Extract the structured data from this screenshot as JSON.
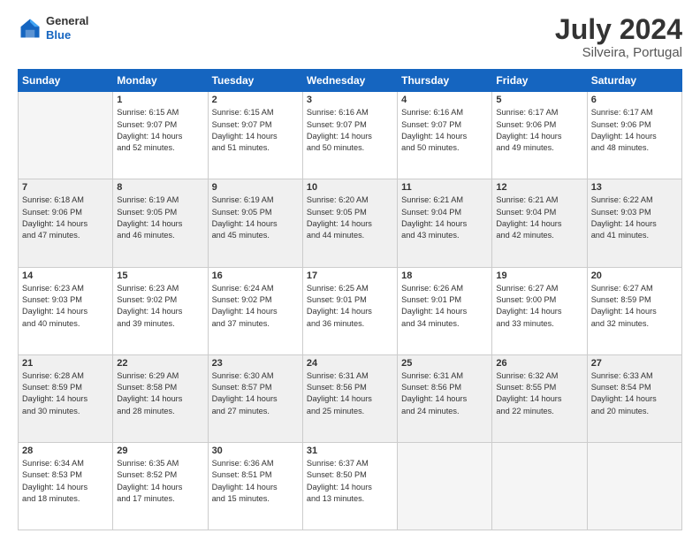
{
  "header": {
    "logo_line1": "General",
    "logo_line2": "Blue",
    "month_year": "July 2024",
    "location": "Silveira, Portugal"
  },
  "weekdays": [
    "Sunday",
    "Monday",
    "Tuesday",
    "Wednesday",
    "Thursday",
    "Friday",
    "Saturday"
  ],
  "weeks": [
    [
      {
        "day": "",
        "info": ""
      },
      {
        "day": "1",
        "info": "Sunrise: 6:15 AM\nSunset: 9:07 PM\nDaylight: 14 hours\nand 52 minutes."
      },
      {
        "day": "2",
        "info": "Sunrise: 6:15 AM\nSunset: 9:07 PM\nDaylight: 14 hours\nand 51 minutes."
      },
      {
        "day": "3",
        "info": "Sunrise: 6:16 AM\nSunset: 9:07 PM\nDaylight: 14 hours\nand 50 minutes."
      },
      {
        "day": "4",
        "info": "Sunrise: 6:16 AM\nSunset: 9:07 PM\nDaylight: 14 hours\nand 50 minutes."
      },
      {
        "day": "5",
        "info": "Sunrise: 6:17 AM\nSunset: 9:06 PM\nDaylight: 14 hours\nand 49 minutes."
      },
      {
        "day": "6",
        "info": "Sunrise: 6:17 AM\nSunset: 9:06 PM\nDaylight: 14 hours\nand 48 minutes."
      }
    ],
    [
      {
        "day": "7",
        "info": "Sunrise: 6:18 AM\nSunset: 9:06 PM\nDaylight: 14 hours\nand 47 minutes."
      },
      {
        "day": "8",
        "info": "Sunrise: 6:19 AM\nSunset: 9:05 PM\nDaylight: 14 hours\nand 46 minutes."
      },
      {
        "day": "9",
        "info": "Sunrise: 6:19 AM\nSunset: 9:05 PM\nDaylight: 14 hours\nand 45 minutes."
      },
      {
        "day": "10",
        "info": "Sunrise: 6:20 AM\nSunset: 9:05 PM\nDaylight: 14 hours\nand 44 minutes."
      },
      {
        "day": "11",
        "info": "Sunrise: 6:21 AM\nSunset: 9:04 PM\nDaylight: 14 hours\nand 43 minutes."
      },
      {
        "day": "12",
        "info": "Sunrise: 6:21 AM\nSunset: 9:04 PM\nDaylight: 14 hours\nand 42 minutes."
      },
      {
        "day": "13",
        "info": "Sunrise: 6:22 AM\nSunset: 9:03 PM\nDaylight: 14 hours\nand 41 minutes."
      }
    ],
    [
      {
        "day": "14",
        "info": "Sunrise: 6:23 AM\nSunset: 9:03 PM\nDaylight: 14 hours\nand 40 minutes."
      },
      {
        "day": "15",
        "info": "Sunrise: 6:23 AM\nSunset: 9:02 PM\nDaylight: 14 hours\nand 39 minutes."
      },
      {
        "day": "16",
        "info": "Sunrise: 6:24 AM\nSunset: 9:02 PM\nDaylight: 14 hours\nand 37 minutes."
      },
      {
        "day": "17",
        "info": "Sunrise: 6:25 AM\nSunset: 9:01 PM\nDaylight: 14 hours\nand 36 minutes."
      },
      {
        "day": "18",
        "info": "Sunrise: 6:26 AM\nSunset: 9:01 PM\nDaylight: 14 hours\nand 34 minutes."
      },
      {
        "day": "19",
        "info": "Sunrise: 6:27 AM\nSunset: 9:00 PM\nDaylight: 14 hours\nand 33 minutes."
      },
      {
        "day": "20",
        "info": "Sunrise: 6:27 AM\nSunset: 8:59 PM\nDaylight: 14 hours\nand 32 minutes."
      }
    ],
    [
      {
        "day": "21",
        "info": "Sunrise: 6:28 AM\nSunset: 8:59 PM\nDaylight: 14 hours\nand 30 minutes."
      },
      {
        "day": "22",
        "info": "Sunrise: 6:29 AM\nSunset: 8:58 PM\nDaylight: 14 hours\nand 28 minutes."
      },
      {
        "day": "23",
        "info": "Sunrise: 6:30 AM\nSunset: 8:57 PM\nDaylight: 14 hours\nand 27 minutes."
      },
      {
        "day": "24",
        "info": "Sunrise: 6:31 AM\nSunset: 8:56 PM\nDaylight: 14 hours\nand 25 minutes."
      },
      {
        "day": "25",
        "info": "Sunrise: 6:31 AM\nSunset: 8:56 PM\nDaylight: 14 hours\nand 24 minutes."
      },
      {
        "day": "26",
        "info": "Sunrise: 6:32 AM\nSunset: 8:55 PM\nDaylight: 14 hours\nand 22 minutes."
      },
      {
        "day": "27",
        "info": "Sunrise: 6:33 AM\nSunset: 8:54 PM\nDaylight: 14 hours\nand 20 minutes."
      }
    ],
    [
      {
        "day": "28",
        "info": "Sunrise: 6:34 AM\nSunset: 8:53 PM\nDaylight: 14 hours\nand 18 minutes."
      },
      {
        "day": "29",
        "info": "Sunrise: 6:35 AM\nSunset: 8:52 PM\nDaylight: 14 hours\nand 17 minutes."
      },
      {
        "day": "30",
        "info": "Sunrise: 6:36 AM\nSunset: 8:51 PM\nDaylight: 14 hours\nand 15 minutes."
      },
      {
        "day": "31",
        "info": "Sunrise: 6:37 AM\nSunset: 8:50 PM\nDaylight: 14 hours\nand 13 minutes."
      },
      {
        "day": "",
        "info": ""
      },
      {
        "day": "",
        "info": ""
      },
      {
        "day": "",
        "info": ""
      }
    ]
  ]
}
